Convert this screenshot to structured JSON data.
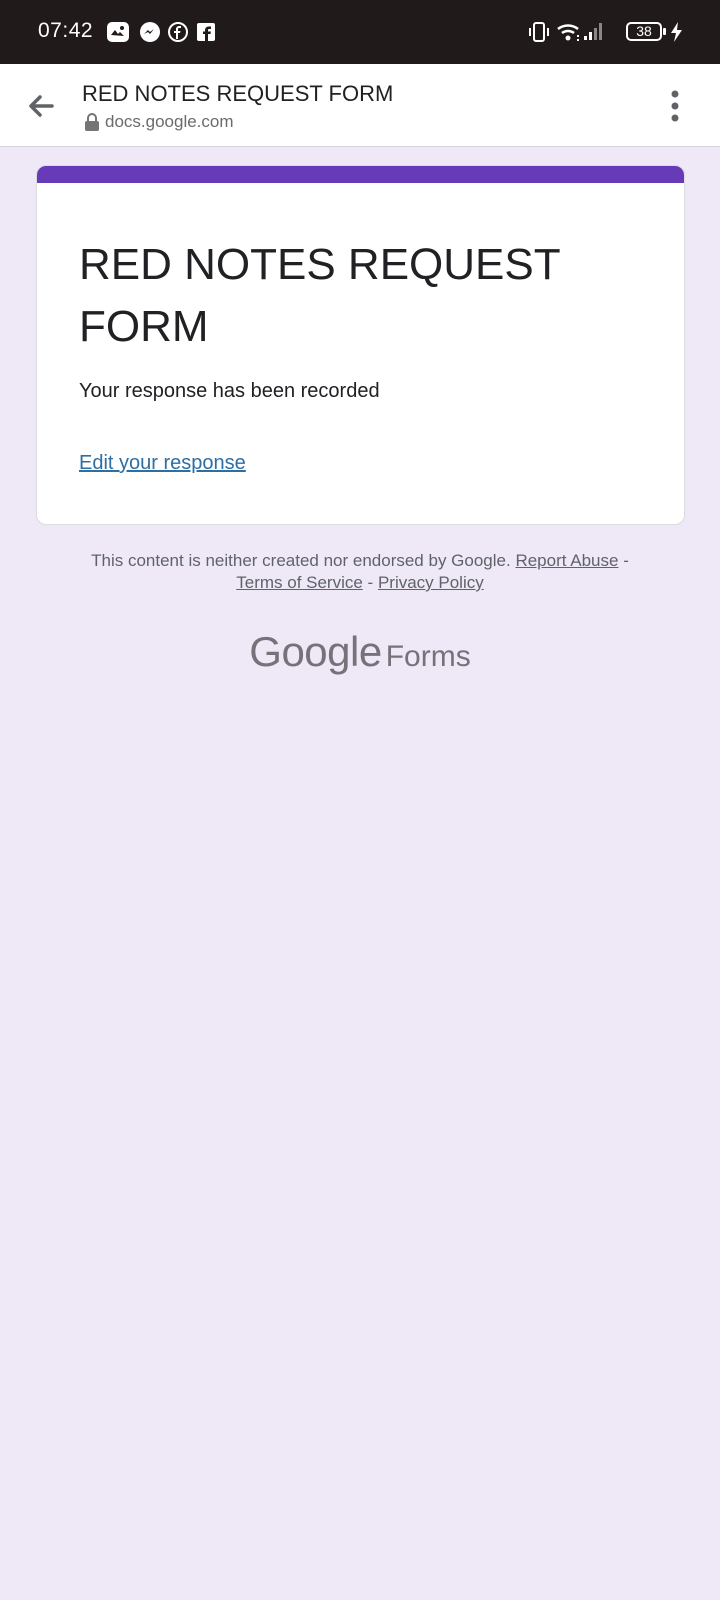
{
  "status_bar": {
    "time": "07:42",
    "battery_level": "38",
    "notification_icons": [
      "gallery-app-icon",
      "messenger-icon",
      "facebook-icon",
      "facebook-square-icon"
    ],
    "system_icons": [
      "vibrate-icon",
      "wifi-icon",
      "signal-icon",
      "battery-icon",
      "charging-icon"
    ]
  },
  "toolbar": {
    "title": "RED NOTES REQUEST FORM",
    "url": "docs.google.com"
  },
  "form": {
    "accent_color": "#673ab7",
    "title": "RED NOTES REQUEST FORM",
    "message": "Your response has been recorded",
    "edit_link": "Edit your response"
  },
  "footer": {
    "disclaimer": "This content is neither created nor endorsed by Google.",
    "report_abuse": "Report Abuse",
    "sep1": " - ",
    "terms": "Terms of Service",
    "sep2": " - ",
    "privacy": "Privacy Policy",
    "brand_google": "Google",
    "brand_forms": "Forms"
  },
  "background_color": "#efe9f7"
}
